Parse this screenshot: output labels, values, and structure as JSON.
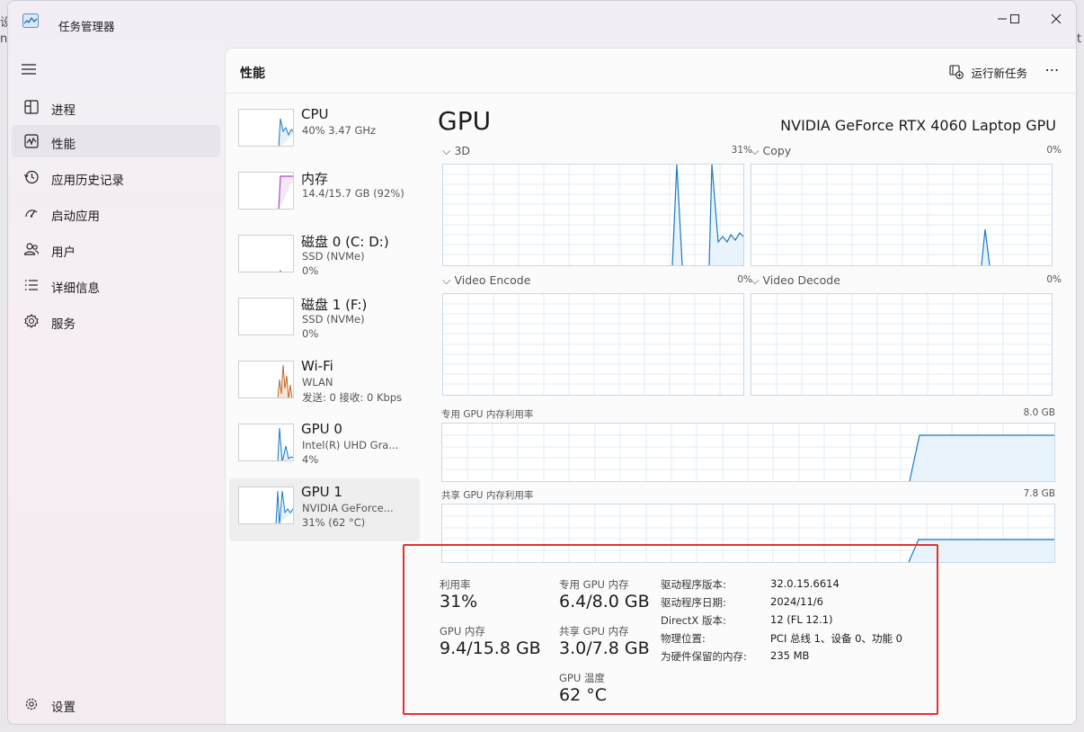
{
  "window": {
    "title": "任务管理器"
  },
  "sidebar": {
    "items": [
      {
        "label": "进程",
        "icon": "processes-icon"
      },
      {
        "label": "性能",
        "icon": "performance-icon"
      },
      {
        "label": "应用历史记录",
        "icon": "app-history-icon"
      },
      {
        "label": "启动应用",
        "icon": "startup-apps-icon"
      },
      {
        "label": "用户",
        "icon": "users-icon"
      },
      {
        "label": "详细信息",
        "icon": "details-icon"
      },
      {
        "label": "服务",
        "icon": "services-icon"
      }
    ],
    "settings_label": "设置"
  },
  "header": {
    "page_title": "性能",
    "run_task_label": "运行新任务",
    "more_label": "⋯"
  },
  "devices": [
    {
      "name": "CPU",
      "sub1": "40% 3.47 GHz",
      "sub2": ""
    },
    {
      "name": "内存",
      "sub1": "14.4/15.7 GB (92%)",
      "sub2": ""
    },
    {
      "name": "磁盘 0 (C: D:)",
      "sub1": "SSD (NVMe)",
      "sub2": "0%"
    },
    {
      "name": "磁盘 1 (F:)",
      "sub1": "SSD (NVMe)",
      "sub2": "0%"
    },
    {
      "name": "Wi-Fi",
      "sub1": "WLAN",
      "sub2": "发送: 0 接收: 0 Kbps"
    },
    {
      "name": "GPU 0",
      "sub1": "Intel(R) UHD Gra...",
      "sub2": "4%"
    },
    {
      "name": "GPU 1",
      "sub1": "NVIDIA GeForce...",
      "sub2": "31% (62 °C)"
    }
  ],
  "gpu": {
    "title": "GPU",
    "model": "NVIDIA GeForce RTX 4060 Laptop GPU",
    "engines": [
      {
        "label": "3D",
        "pct": "31%"
      },
      {
        "label": "Copy",
        "pct": "0%"
      },
      {
        "label": "Video Encode",
        "pct": "0%"
      },
      {
        "label": "Video Decode",
        "pct": "0%"
      }
    ],
    "dedicated_label": "专用 GPU 内存利用率",
    "dedicated_max": "8.0 GB",
    "shared_label": "共享 GPU 内存利用率",
    "shared_max": "7.8 GB"
  },
  "stats": {
    "utilization_label": "利用率",
    "utilization_value": "31%",
    "gpu_mem_label": "GPU 内存",
    "gpu_mem_value": "9.4/15.8 GB",
    "dedicated_label": "专用 GPU 内存",
    "dedicated_value": "6.4/8.0 GB",
    "shared_label": "共享 GPU 内存",
    "shared_value": "3.0/7.8 GB",
    "temp_label": "GPU 温度",
    "temp_value": "62 °C"
  },
  "details": [
    {
      "key": "驱动程序版本:",
      "value": "32.0.15.6614"
    },
    {
      "key": "驱动程序日期:",
      "value": "2024/11/6"
    },
    {
      "key": "DirectX 版本:",
      "value": "12 (FL 12.1)"
    },
    {
      "key": "物理位置:",
      "value": "PCI 总线 1、设备 0、功能 0"
    },
    {
      "key": "为硬件保留的内存:",
      "value": "235 MB"
    }
  ],
  "colors": {
    "gpu_line": "#1a7ac1",
    "mem_line": "#a14fc6",
    "disk_line": "#4aa64a",
    "wifi_line": "#c1672a",
    "highlight": "#e33236"
  }
}
